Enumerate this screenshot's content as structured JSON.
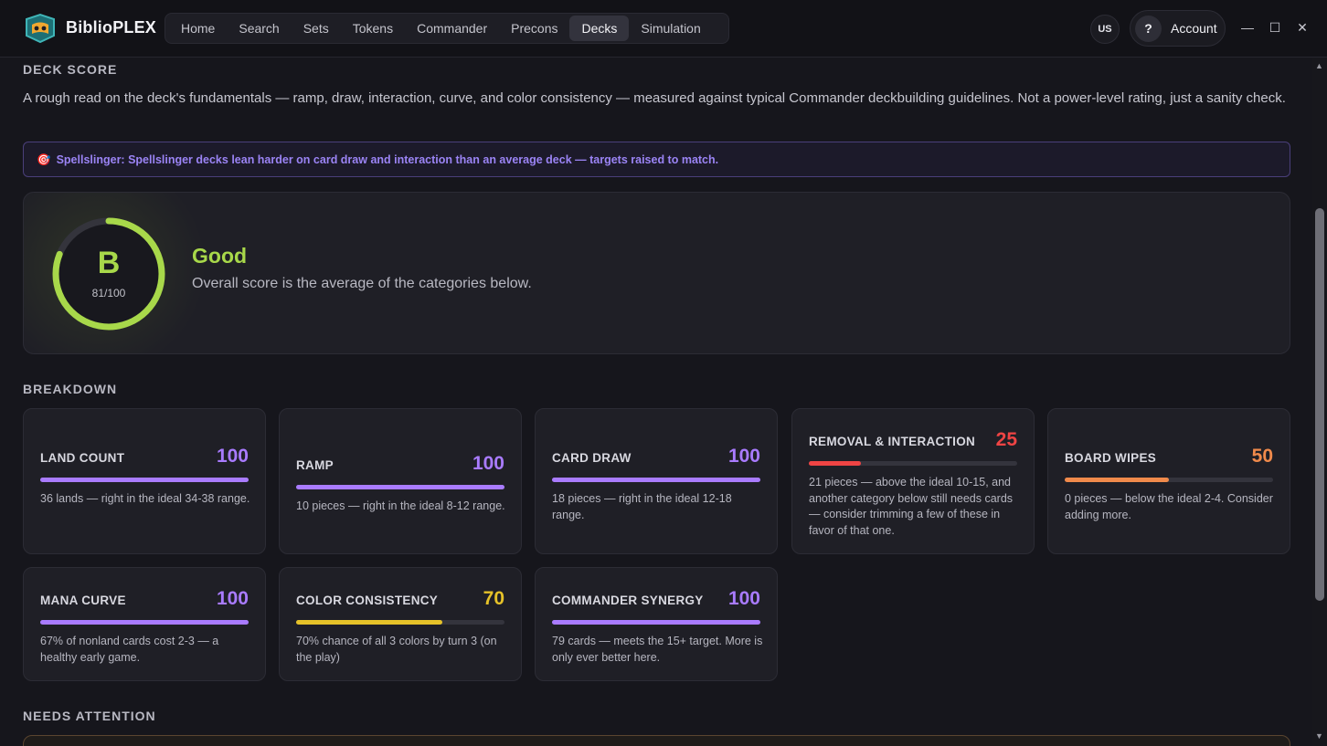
{
  "app": {
    "brand": "BiblioPLEX"
  },
  "nav": {
    "items": [
      {
        "label": "Home"
      },
      {
        "label": "Search"
      },
      {
        "label": "Sets"
      },
      {
        "label": "Tokens"
      },
      {
        "label": "Commander"
      },
      {
        "label": "Precons"
      },
      {
        "label": "Decks"
      },
      {
        "label": "Simulation"
      }
    ],
    "active": "Decks"
  },
  "header": {
    "lang": "US",
    "account_icon": "?",
    "account_label": "Account"
  },
  "window_controls": {
    "minimize": "—",
    "maximize": "☐",
    "close": "✕"
  },
  "deck_score": {
    "title": "DECK SCORE",
    "intro": "A rough read on the deck's fundamentals — ramp, draw, interaction, curve, and color consistency — measured against typical Commander deckbuilding guidelines. Not a power-level rating, just a sanity check.",
    "banner_icon": "🎯",
    "banner_text": "Spellslinger: Spellslinger decks lean harder on card draw and interaction than an average deck — targets raised to match.",
    "grade": "B",
    "score_text": "81/100",
    "score_value": 81,
    "grade_label": "Good",
    "grade_desc": "Overall score is the average of the categories below.",
    "grade_color": "#a8d84a"
  },
  "breakdown": {
    "title": "BREAKDOWN",
    "categories": [
      {
        "name": "LAND COUNT",
        "value": "100",
        "pct": 100,
        "color": "#a97bff",
        "note": "36 lands — right in the ideal 34-38 range."
      },
      {
        "name": "RAMP",
        "value": "100",
        "pct": 100,
        "color": "#a97bff",
        "note": "10 pieces — right in the ideal 8-12 range."
      },
      {
        "name": "CARD DRAW",
        "value": "100",
        "pct": 100,
        "color": "#a97bff",
        "note": "18 pieces — right in the ideal 12-18 range."
      },
      {
        "name": "REMOVAL & INTERACTION",
        "value": "25",
        "pct": 25,
        "color": "#ef4444",
        "note": "21 pieces — above the ideal 10-15, and another category below still needs cards — consider trimming a few of these in favor of that one."
      },
      {
        "name": "BOARD WIPES",
        "value": "50",
        "pct": 50,
        "color": "#f08a4b",
        "note": "0 pieces — below the ideal 2-4. Consider adding more."
      },
      {
        "name": "MANA CURVE",
        "value": "100",
        "pct": 100,
        "color": "#a97bff",
        "note": "67% of nonland cards cost 2-3 — a healthy early game."
      },
      {
        "name": "COLOR CONSISTENCY",
        "value": "70",
        "pct": 70,
        "color": "#e6c229",
        "note": "70% chance of all 3 colors by turn 3 (on the play)"
      },
      {
        "name": "COMMANDER SYNERGY",
        "value": "100",
        "pct": 100,
        "color": "#a97bff",
        "note": "79 cards — meets the 15+ target. More is only ever better here."
      }
    ]
  },
  "needs_attention": {
    "title": "NEEDS ATTENTION"
  }
}
